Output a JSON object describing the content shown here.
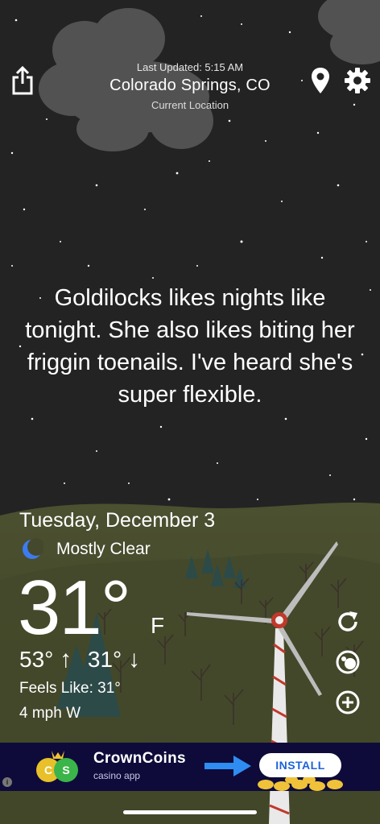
{
  "header": {
    "last_updated": "Last Updated: 5:15 AM",
    "city": "Colorado Springs, CO",
    "location_label": "Current Location"
  },
  "quote": "Goldilocks likes nights like tonight. She also likes biting her friggin toenails. I've heard she's super flexible.",
  "weather": {
    "date": "Tuesday, December 3",
    "condition": "Mostly Clear",
    "temperature": "31°",
    "unit": "F",
    "high": "53°",
    "low": "31°",
    "feels_like": "Feels Like: 31°",
    "wind": "4 mph W"
  },
  "ad": {
    "brand": "CrownCoins",
    "subtitle": "casino app",
    "cta": "INSTALL",
    "info": "i"
  },
  "icons": {
    "share": "share-icon",
    "location": "location-pin-icon",
    "settings": "gear-icon",
    "refresh": "refresh-icon",
    "radar": "radar-icon",
    "add": "plus-circle-icon",
    "moon": "moon-icon"
  },
  "colors": {
    "sky": "#232323",
    "hill": "#4a5130",
    "ad_bg": "#0e0b3a",
    "install_text": "#1d63d8",
    "moon": "#3d7bf0"
  }
}
